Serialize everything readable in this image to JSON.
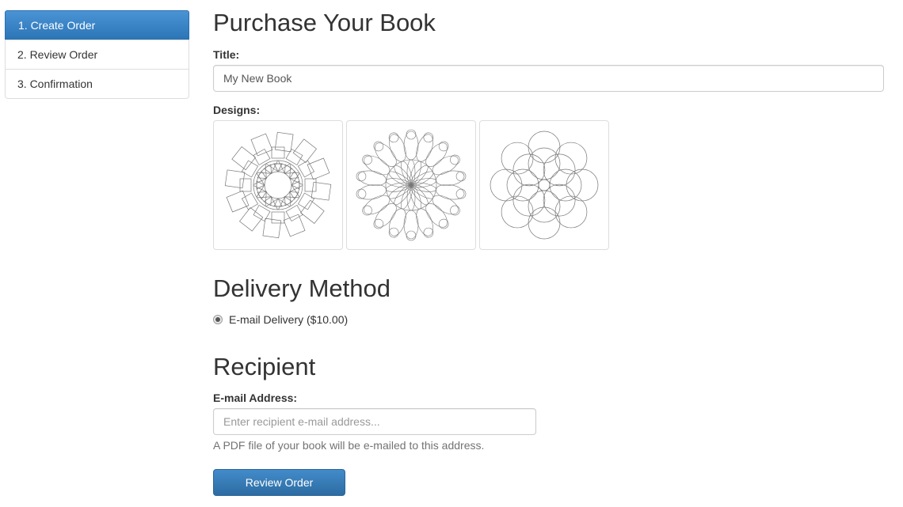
{
  "sidebar": {
    "items": [
      {
        "label": "1. Create Order",
        "active": true
      },
      {
        "label": "2. Review Order",
        "active": false
      },
      {
        "label": "3. Confirmation",
        "active": false
      }
    ]
  },
  "main": {
    "title": "Purchase Your Book",
    "title_field": {
      "label": "Title:",
      "value": "My New Book"
    },
    "designs": {
      "label": "Designs:",
      "items": [
        "mandala-design-1",
        "mandala-design-2",
        "mandala-design-3"
      ]
    },
    "delivery": {
      "heading": "Delivery Method",
      "option_label": "E-mail Delivery ($10.00)",
      "selected": true
    },
    "recipient": {
      "heading": "Recipient",
      "email_label": "E-mail Address:",
      "email_placeholder": "Enter recipient e-mail address...",
      "help_text": "A PDF file of your book will be e-mailed to this address."
    },
    "submit_label": "Review Order"
  },
  "colors": {
    "accent": "#337ab7",
    "border": "#dddddd"
  }
}
